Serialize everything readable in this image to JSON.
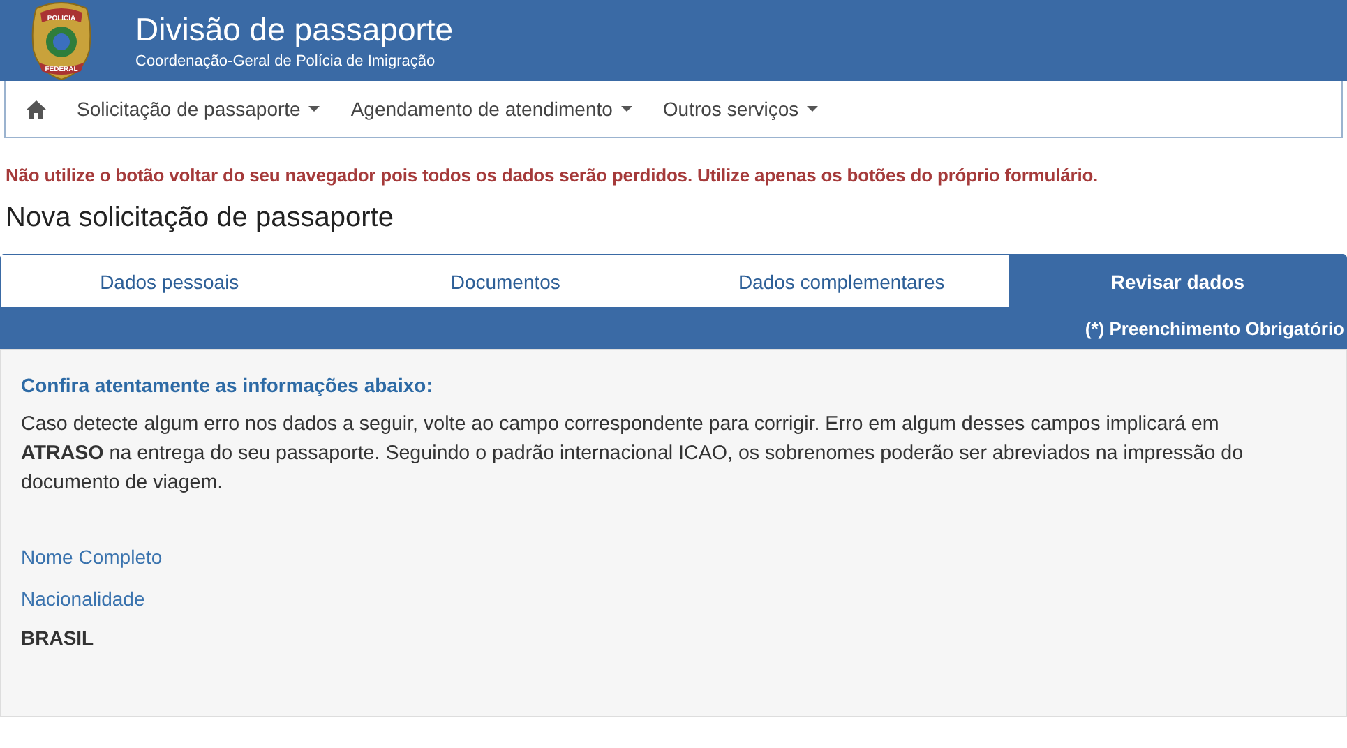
{
  "header": {
    "badge": {
      "top": "POLICIA",
      "bottom": "FEDERAL"
    },
    "title": "Divisão de passaporte",
    "subtitle": "Coordenação-Geral de Polícia de Imigração"
  },
  "nav": {
    "items": [
      {
        "label": "Solicitação de passaporte",
        "dropdown": true
      },
      {
        "label": "Agendamento de atendimento",
        "dropdown": true
      },
      {
        "label": "Outros serviços",
        "dropdown": true
      }
    ]
  },
  "warning": "Não utilize o botão voltar do seu navegador pois todos os dados serão perdidos. Utilize apenas os botões do próprio formulário.",
  "page_title": "Nova solicitação de passaporte",
  "tabs": [
    {
      "label": "Dados pessoais",
      "selected": false
    },
    {
      "label": "Documentos",
      "selected": false
    },
    {
      "label": "Dados complementares",
      "selected": false
    },
    {
      "label": "Revisar dados",
      "selected": true
    }
  ],
  "required_note": "(*) Preenchimento Obrigatório",
  "panel": {
    "heading": "Confira atentamente as informações abaixo:",
    "text": "Caso detecte algum erro nos dados a seguir, volte ao campo correspondente para corrigir. Erro em algum desses campos implicará em **ATRASO** na entrega do seu passaporte. Seguindo o padrão internacional ICAO, os sobrenomes poderão ser abreviados na impressão do documento de viagem.",
    "fields": [
      {
        "label": "Nome Completo"
      },
      {
        "label": "Nacionalidade",
        "value": "BRASIL"
      }
    ]
  }
}
